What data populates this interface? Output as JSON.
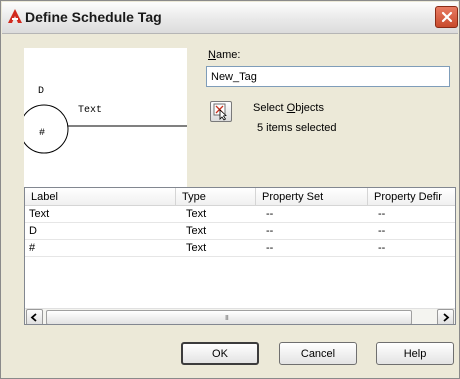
{
  "window": {
    "title": "Define Schedule Tag",
    "close_glyph": "✕"
  },
  "preview": {
    "attribute_label": "D",
    "text_label": "Text",
    "circle_label": "#"
  },
  "name": {
    "label_prefix": "",
    "label_mnemonic": "N",
    "label_rest": "ame:",
    "value": "New_Tag"
  },
  "select_objects": {
    "label_prefix": "Select ",
    "label_mnemonic": "O",
    "label_rest": "bjects",
    "status": "5 items selected"
  },
  "grid": {
    "columns": [
      "Label",
      "Type",
      "Property Set",
      "Property Defir"
    ],
    "rows": [
      [
        "Text",
        "Text",
        "--",
        "--"
      ],
      [
        "D",
        "Text",
        "--",
        "--"
      ],
      [
        "#",
        "Text",
        "--",
        "--"
      ]
    ],
    "scroll_left_glyph": "<",
    "scroll_right_glyph": ">",
    "scroll_grip": "III"
  },
  "buttons": {
    "ok": "OK",
    "cancel": "Cancel",
    "help": "Help"
  },
  "colors": {
    "dialog_bg": "#ece9d8",
    "close_button": "#c84a2c",
    "input_border": "#7f9db9"
  }
}
